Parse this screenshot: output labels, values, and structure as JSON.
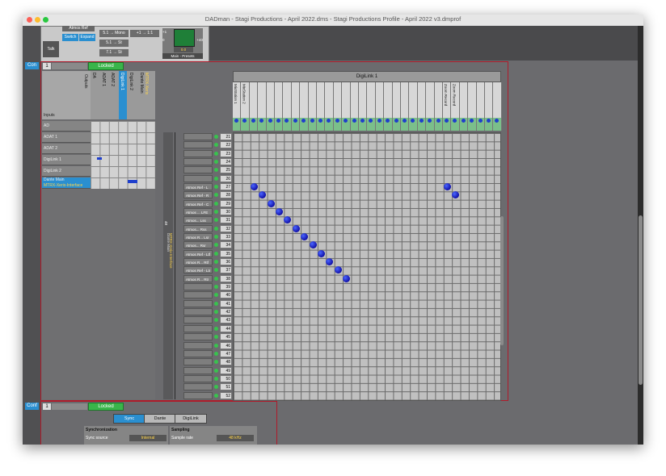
{
  "window": {
    "title": "DADman - Stagi Productions - April 2022.dms - Stagi Productions Profile - April 2022 v3.dmprof"
  },
  "monitor": {
    "talk_label": "Talk",
    "atmos_ref": "Atmos Ref",
    "switch_label": "Switch",
    "expand_label": "Expand",
    "mono_btn": "5.1 → Mono",
    "plus1_btn": "+1 → 1:1",
    "stereo_btn": "5.1 → St",
    "one_btn": "7.1 → St",
    "level_labels": [
      "+1",
      "0",
      "+40"
    ],
    "gain": "0.0",
    "meter_name": "Main - Presets"
  },
  "con_section": {
    "tag": "Con",
    "page_number": "1",
    "status": "Locked",
    "outputs_label": "Outputs",
    "inputs_label": "Inputs",
    "output_columns": [
      "DA",
      "ADAT 1",
      "ADAT 2",
      "DigiLink 1",
      "DigiLink 2",
      "Dante Main",
      "MTRX-Xerix"
    ],
    "input_rows": [
      "AD",
      "ADAT 1",
      "ADAT 2",
      "DigiLink 1",
      "DigiLink 2",
      "Dante Main"
    ],
    "dante_sub": "MTRX-Xerix-Interface",
    "side_label": "Dante Main",
    "side_sub": "MTRX-Xerix-Interface",
    "side_num": "48",
    "group_header": "DigiLink 1",
    "channel_headers": [
      "MixStation 1",
      "MixStation 2",
      "",
      "",
      "",
      "",
      "",
      "",
      "",
      "",
      "",
      "",
      "",
      "",
      "",
      "",
      "",
      "",
      "",
      "",
      "",
      "",
      "",
      "",
      "",
      "Zoom Record",
      "Zoom Record",
      "",
      "",
      "",
      "",
      ""
    ],
    "row_numbers": [
      "21",
      "22",
      "23",
      "24",
      "25",
      "26",
      "27",
      "28",
      "29",
      "30",
      "31",
      "32",
      "33",
      "34",
      "35",
      "36",
      "37",
      "38",
      "39",
      "40",
      "41",
      "42",
      "43",
      "44",
      "45",
      "46",
      "47",
      "48",
      "49",
      "50",
      "51",
      "52"
    ],
    "row_names": [
      "",
      "",
      "",
      "",
      "",
      "",
      "Atmos Ref - L",
      "Atmos Ref - R",
      "Atmos Ref - C",
      "Atmos ... LFE",
      "Atmos... Lss",
      "Atmos... Rss",
      "Atmos R... Lsr",
      "Atmos... Rsr",
      "Atmos Ref - Ltf",
      "Atmos R... Rtf",
      "Atmos Ref - Ltr",
      "Atmos R... Rtr",
      "",
      "",
      "",
      "",
      "",
      "",
      "",
      "",
      "",
      "",
      "",
      "",
      "",
      ""
    ]
  },
  "conf_section": {
    "tag": "Conf",
    "page_number": "1",
    "status": "Locked",
    "tabs": [
      "Sync",
      "Dante",
      "DigiLink"
    ],
    "sync_header": "Synchronization",
    "sync_source_label": "Sync source",
    "sync_source_value": "Internal",
    "sampling_header": "Sampling",
    "sample_rate_label": "Sample rate",
    "sample_rate_value": "48 kHz"
  },
  "colors": {
    "accent": "#2a8fd0",
    "locked": "#39b54a",
    "outline": "#b01a2a",
    "route_dot": "#1f3fcc"
  }
}
